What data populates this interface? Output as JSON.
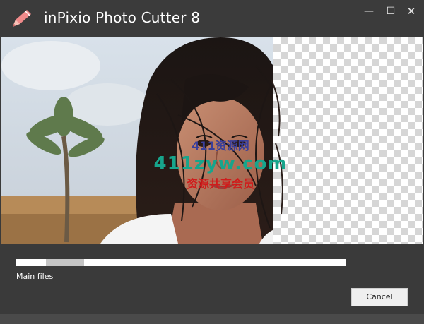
{
  "window": {
    "title": "inPixio Photo Cutter 8",
    "icons": {
      "logo": "pencil-logo-icon",
      "minimize": "minimize-icon",
      "maximize": "maximize-icon",
      "close": "close-icon"
    },
    "controls": {
      "minimize_glyph": "—",
      "maximize_glyph": "☐",
      "close_glyph": "✕"
    }
  },
  "preview": {
    "watermark_lines": [
      "411资源网",
      "411zyw.com",
      "资源共享会员"
    ]
  },
  "progress": {
    "status_text": "Main files",
    "segment_start": 0.09,
    "segment_end": 0.205
  },
  "actions": {
    "cancel_label": "Cancel"
  },
  "colors": {
    "background": "#3a3a3a",
    "logo_accent": "#f08a8a",
    "progress_track": "#ffffff",
    "progress_fill": "#c5c5c5"
  }
}
